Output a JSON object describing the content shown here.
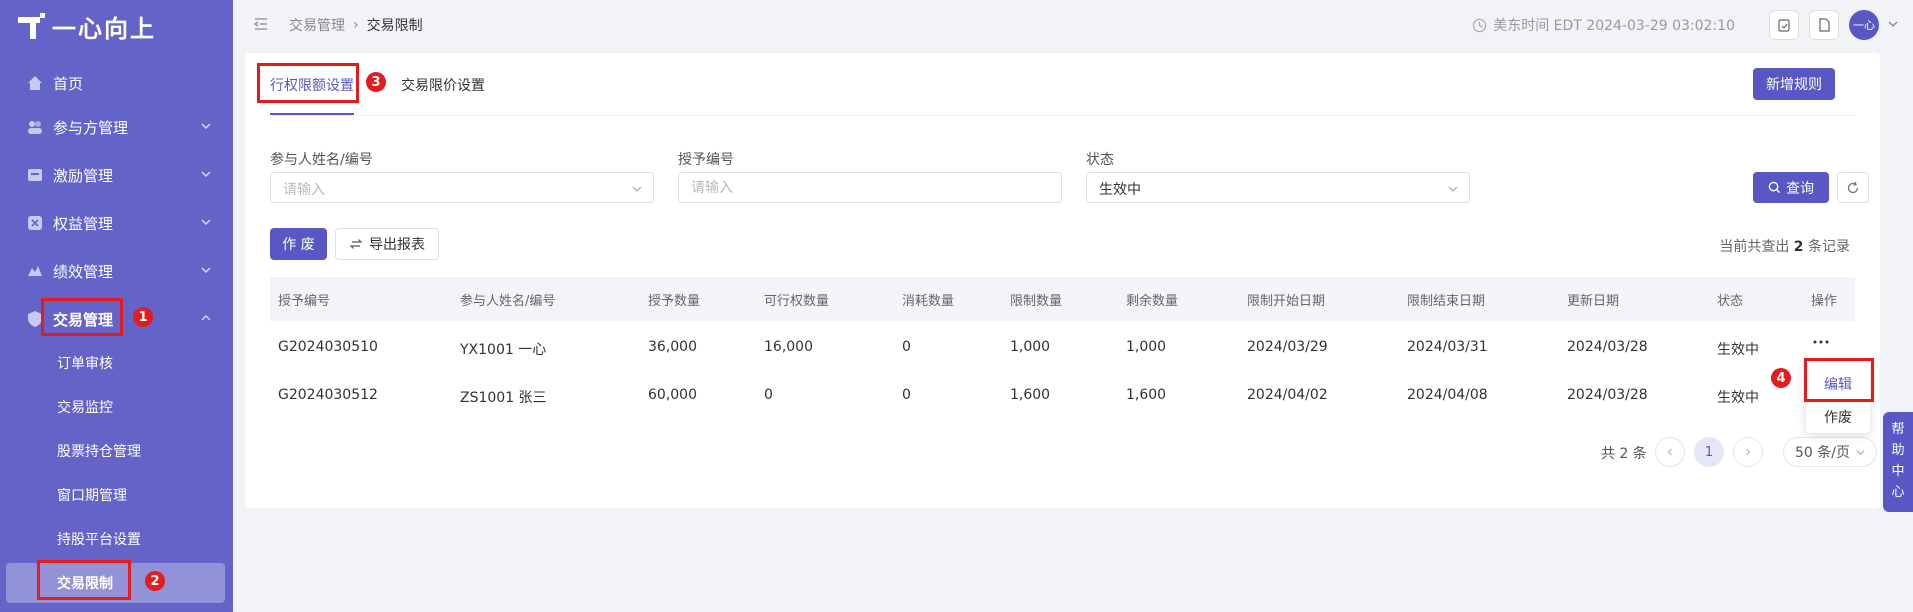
{
  "brand": {
    "name": "一心向上"
  },
  "sidebar": {
    "items": [
      {
        "label": "首页"
      },
      {
        "label": "参与方管理"
      },
      {
        "label": "激励管理"
      },
      {
        "label": "权益管理"
      },
      {
        "label": "绩效管理"
      },
      {
        "label": "交易管理"
      }
    ],
    "sub_items": [
      {
        "label": "订单审核"
      },
      {
        "label": "交易监控"
      },
      {
        "label": "股票持仓管理"
      },
      {
        "label": "窗口期管理"
      },
      {
        "label": "持股平台设置"
      },
      {
        "label": "交易限制"
      }
    ]
  },
  "header": {
    "breadcrumb": [
      "交易管理",
      "交易限制"
    ],
    "time": "美东时间 EDT 2024-03-29 03:02:10",
    "avatar_text": "一心"
  },
  "tabs": [
    {
      "label": "行权限额设置"
    },
    {
      "label": "交易限价设置"
    }
  ],
  "actions": {
    "add_rule": "新增规则"
  },
  "filters": {
    "participant": {
      "label": "参与人姓名/编号",
      "placeholder": "请输入"
    },
    "grant_no": {
      "label": "授予编号",
      "placeholder": "请输入"
    },
    "status": {
      "label": "状态",
      "value": "生效中"
    },
    "query_label": "查询"
  },
  "toolbar": {
    "void_label": "作 废",
    "export_label": "导出报表",
    "record_prefix": "当前共查出",
    "record_count": "2",
    "record_suffix": "条记录"
  },
  "table": {
    "columns": [
      "授予编号",
      "参与人姓名/编号",
      "授予数量",
      "可行权数量",
      "消耗数量",
      "限制数量",
      "剩余数量",
      "限制开始日期",
      "限制结束日期",
      "更新日期",
      "状态",
      "操作"
    ],
    "rows": [
      [
        "G2024030510",
        "YX1001 一心",
        "36,000",
        "16,000",
        "0",
        "1,000",
        "1,000",
        "2024/03/29",
        "2024/03/31",
        "2024/03/28",
        "生效中"
      ],
      [
        "G2024030512",
        "ZS1001 张三",
        "60,000",
        "0",
        "0",
        "1,600",
        "1,600",
        "2024/04/02",
        "2024/04/08",
        "2024/03/28",
        "生效中"
      ]
    ]
  },
  "row_menu": {
    "edit": "编辑",
    "void": "作废"
  },
  "pagination": {
    "total": "共 2 条",
    "current": "1",
    "page_size": "50 条/页"
  },
  "annotations": [
    "1",
    "2",
    "3",
    "4"
  ],
  "help": "帮助中心",
  "colors": {
    "sidebar": "#6463c8",
    "primary": "#5957c4",
    "annotation": "#e31d1d"
  }
}
